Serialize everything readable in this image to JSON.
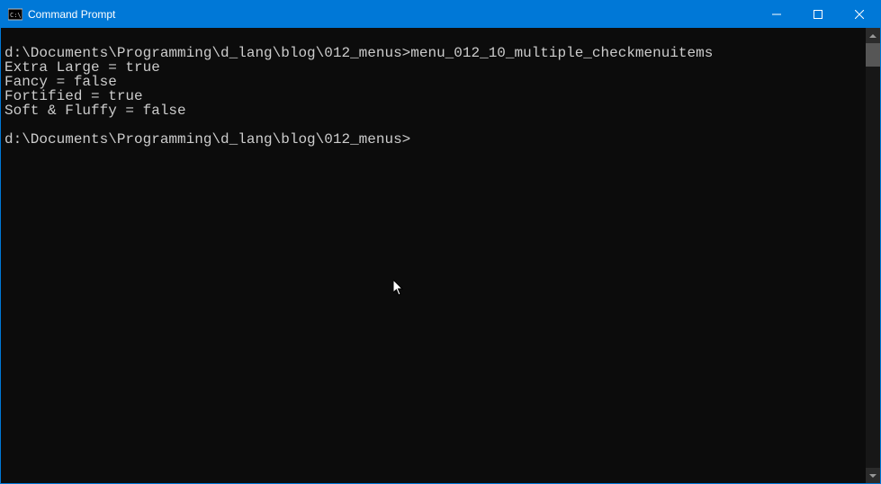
{
  "window": {
    "title": "Command Prompt"
  },
  "terminal": {
    "lines": [
      "",
      "d:\\Documents\\Programming\\d_lang\\blog\\012_menus>menu_012_10_multiple_checkmenuitems",
      "Extra Large = true",
      "Fancy = false",
      "Fortified = true",
      "Soft & Fluffy = false",
      "",
      "d:\\Documents\\Programming\\d_lang\\blog\\012_menus>"
    ]
  },
  "colors": {
    "titlebar": "#0078d7",
    "background": "#0c0c0c",
    "text": "#cccccc"
  }
}
